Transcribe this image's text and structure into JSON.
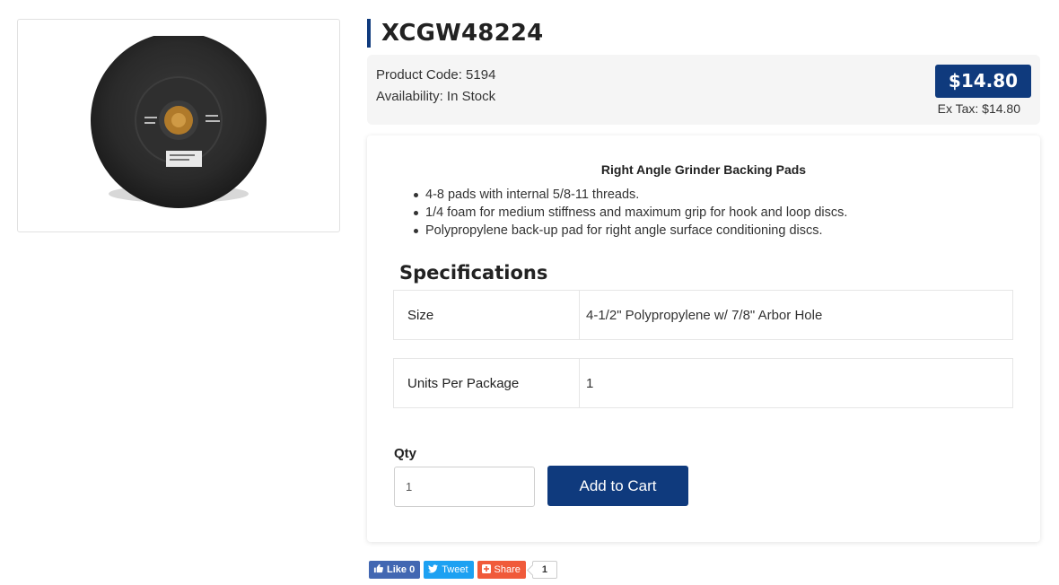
{
  "product": {
    "title": "XCGW48224",
    "image_alt": "Grinder backing pad",
    "code_line": "Product Code: 5194",
    "availability_line": "Availability: In Stock",
    "price": "$14.80",
    "ex_tax": "Ex Tax: $14.80"
  },
  "description": {
    "heading": "Right Angle Grinder Backing Pads",
    "bullets": [
      "4-8 pads with internal 5/8-11 threads.",
      "1/4 foam for medium stiffness and maximum grip for hook and loop discs.",
      "Polypropylene back-up pad for right angle surface conditioning discs."
    ]
  },
  "specifications": {
    "title": "Specifications",
    "rows": [
      {
        "key": "Size",
        "value": "4-1/2\" Polypropylene w/ 7/8\" Arbor Hole"
      },
      {
        "key": "Units Per Package",
        "value": "1"
      }
    ]
  },
  "cart": {
    "qty_label": "Qty",
    "qty_value": "1",
    "add_label": "Add to Cart"
  },
  "social": {
    "like": "Like 0",
    "tweet": "Tweet",
    "share": "Share",
    "count": "1"
  },
  "colors": {
    "brand": "#0f3a7d",
    "facebook": "#4267b2",
    "twitter": "#1da1f2",
    "share": "#f05a3a"
  }
}
